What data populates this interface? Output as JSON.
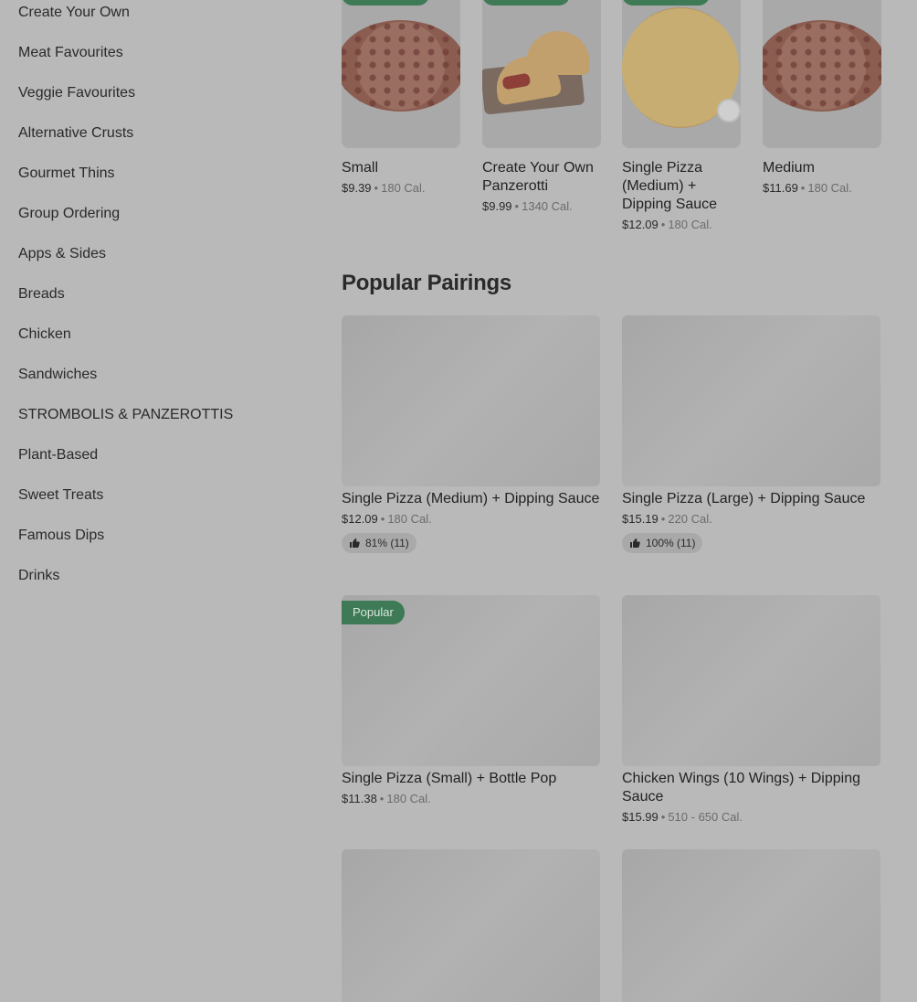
{
  "sidebar": {
    "items": [
      {
        "label": "Create Your Own"
      },
      {
        "label": "Meat Favourites"
      },
      {
        "label": "Veggie Favourites"
      },
      {
        "label": "Alternative Crusts"
      },
      {
        "label": "Gourmet Thins"
      },
      {
        "label": "Group Ordering"
      },
      {
        "label": "Apps & Sides"
      },
      {
        "label": "Breads"
      },
      {
        "label": "Chicken"
      },
      {
        "label": "Sandwiches"
      },
      {
        "label": "STROMBOLIS & PANZEROTTIS"
      },
      {
        "label": "Plant-Based"
      },
      {
        "label": "Sweet Treats"
      },
      {
        "label": "Famous Dips"
      },
      {
        "label": "Drinks"
      }
    ]
  },
  "carousel": {
    "items": [
      {
        "name": "Small",
        "price": "$9.39",
        "calories": "180 Cal."
      },
      {
        "name": "Create Your Own Panzerotti",
        "price": "$9.99",
        "calories": "1340 Cal."
      },
      {
        "name": "Single Pizza (Medium) + Dipping Sauce",
        "price": "$12.09",
        "calories": "180 Cal."
      },
      {
        "name": "Medium",
        "price": "$11.69",
        "calories": "180 Cal."
      }
    ]
  },
  "separator": "•",
  "pairings": {
    "title": "Popular Pairings",
    "items": [
      {
        "name": "Single Pizza (Medium) + Dipping Sauce",
        "price": "$12.09",
        "calories": "180 Cal.",
        "rating": "81% (11)"
      },
      {
        "name": "Single Pizza (Large) + Dipping Sauce",
        "price": "$15.19",
        "calories": "220 Cal.",
        "rating": "100% (11)"
      },
      {
        "name": "Single Pizza (Small) + Bottle Pop",
        "price": "$11.38",
        "calories": "180 Cal.",
        "badge": "Popular"
      },
      {
        "name": "Chicken Wings (10 Wings) + Dipping Sauce",
        "price": "$15.99",
        "calories": "510 - 650 Cal."
      }
    ]
  },
  "colors": {
    "badge": "#3e7a55",
    "overlay": "#b9b9b9"
  }
}
